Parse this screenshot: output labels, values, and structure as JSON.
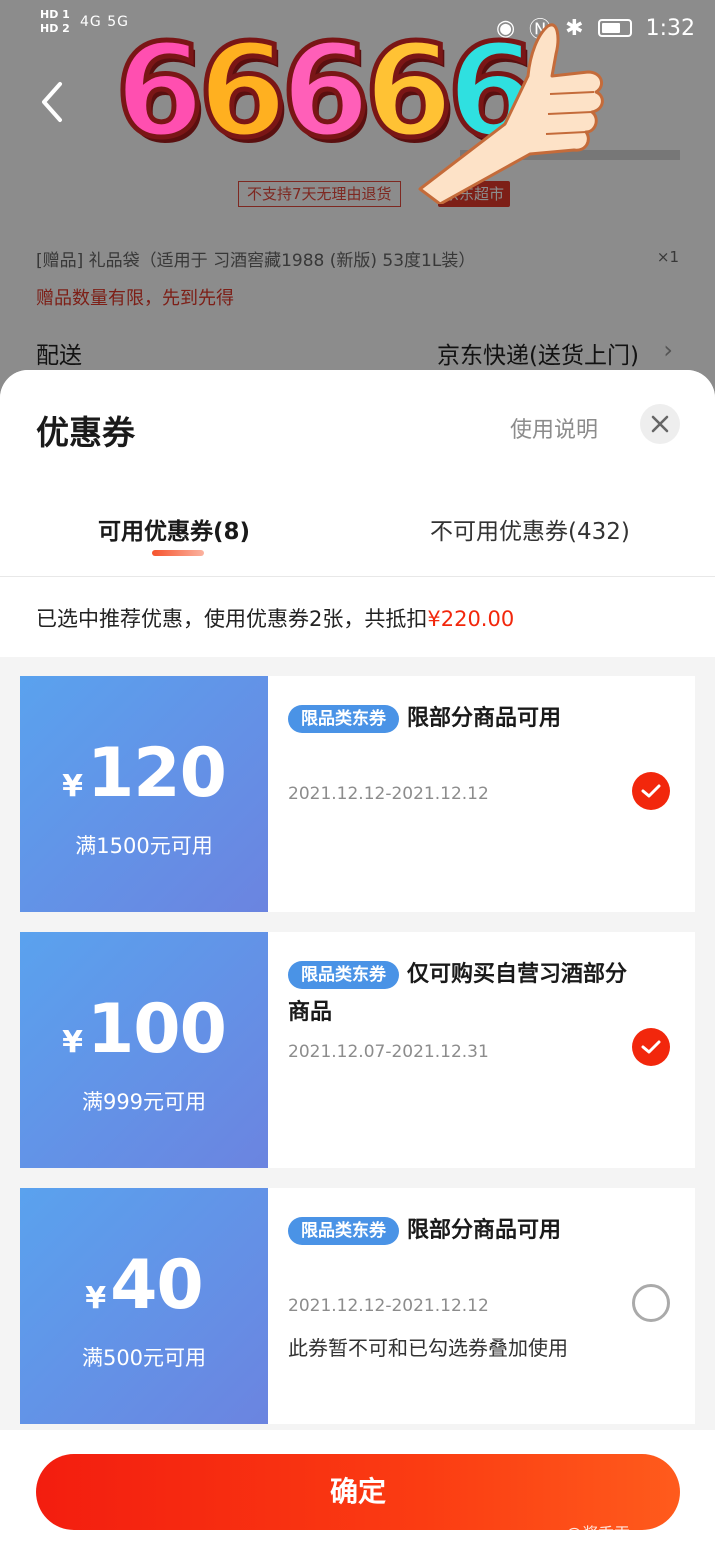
{
  "status_bar": {
    "left_labels": [
      "HD 1",
      "HD 2"
    ],
    "network": "4G 5G",
    "time": "1:32"
  },
  "sticker": {
    "digits": [
      "6",
      "6",
      "6",
      "6",
      "6"
    ]
  },
  "product": {
    "no_refund_tag": "不支持7天无理由退货",
    "store_tag": "京东超市",
    "gift_line": "[赠品]  礼品袋（适用于 习酒窖藏1988 (新版) 53度1L装）",
    "gift_qty": "×1",
    "gift_note": "赠品数量有限，先到先得",
    "delivery_label": "配送",
    "delivery_value": "京东快递(送货上门)"
  },
  "sheet": {
    "title": "优惠券",
    "usage_link": "使用说明",
    "tabs": [
      {
        "label": "可用优惠券(8)",
        "active": true
      },
      {
        "label": "不可用优惠券(432)",
        "active": false
      }
    ],
    "summary_text": "已选中推荐优惠，使用优惠券2张，共抵扣",
    "summary_amount": "¥220.00",
    "confirm_label": "确定"
  },
  "coupons": [
    {
      "currency": "¥",
      "amount": "120",
      "threshold": "满1500元可用",
      "badge": "限品类东券",
      "description": "限部分商品可用",
      "date": "2021.12.12-2021.12.12",
      "note": "",
      "selected": true
    },
    {
      "currency": "¥",
      "amount": "100",
      "threshold": "满999元可用",
      "badge": "限品类东券",
      "description": "仅可购买自营习酒部分商品",
      "date": "2021.12.07-2021.12.31",
      "note": "",
      "selected": true
    },
    {
      "currency": "¥",
      "amount": "40",
      "threshold": "满500元可用",
      "badge": "限品类东券",
      "description": "限部分商品可用",
      "date": "2021.12.12-2021.12.12",
      "note": "此券暂不可和已勾选券叠加使用",
      "selected": false
    }
  ],
  "colors": {
    "accent_red": "#f2270c",
    "coupon_blue": "#5aa2ee",
    "badge_blue": "#4a93e6"
  },
  "watermark": "@酱香贡"
}
